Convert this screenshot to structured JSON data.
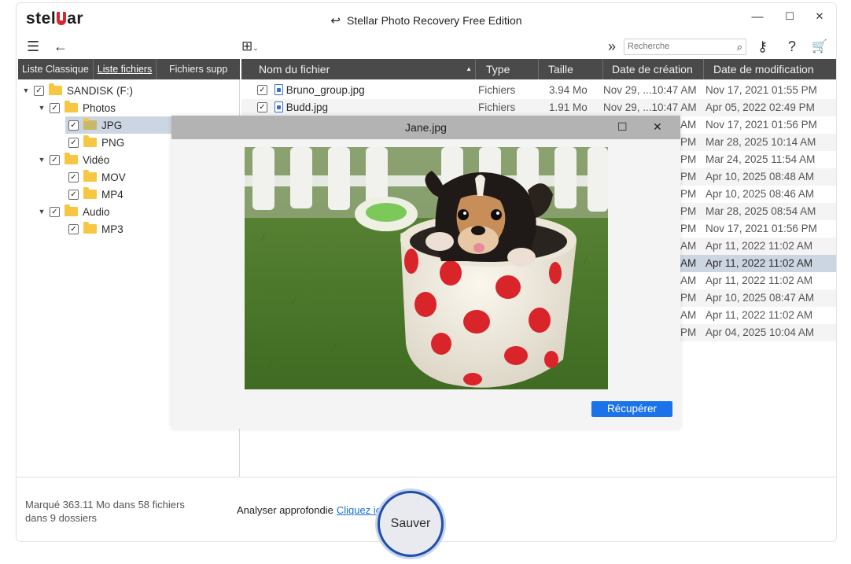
{
  "app": {
    "logo_left": "stel",
    "logo_right": "ar",
    "title": "Stellar Photo Recovery Free Edition",
    "window_controls": [
      "—",
      "☐",
      "✕"
    ]
  },
  "toolbar": {
    "menu_icon": "☰",
    "back_icon": "←",
    "view_icon": "⊞",
    "more_icon": "»",
    "search_placeholder": "Recherche",
    "search_icon": "⌕",
    "key_icon": "⚷",
    "help_icon": "?",
    "cart_icon": "🛒"
  },
  "left_tabs": [
    "Liste Classique",
    "Liste fichiers",
    "Fichiers supp"
  ],
  "tree": [
    {
      "label": "SANDISK (F:)",
      "arrow": "▼",
      "checked": "✓"
    },
    {
      "label": "Photos",
      "arrow": "▼",
      "checked": "✓"
    },
    {
      "label": "JPG",
      "arrow": "",
      "checked": "✓"
    },
    {
      "label": "PNG",
      "arrow": "",
      "checked": "✓"
    },
    {
      "label": "Vidéo",
      "arrow": "▼",
      "checked": "✓"
    },
    {
      "label": "MOV",
      "arrow": "",
      "checked": "✓"
    },
    {
      "label": "MP4",
      "arrow": "",
      "checked": "✓"
    },
    {
      "label": "Audio",
      "arrow": "▼",
      "checked": "✓"
    },
    {
      "label": "MP3",
      "arrow": "",
      "checked": "✓"
    }
  ],
  "table": {
    "columns": [
      "Nom du fichier",
      "Type",
      "Taille",
      "Date de création",
      "Date de modification"
    ],
    "sort_icon": "▲",
    "rows": [
      {
        "name": "Bruno_group.jpg",
        "type": "Fichiers",
        "size": "3.94 Mo",
        "created": "Nov 29, ...10:47 AM",
        "modified": "Nov 17, 2021 01:55 PM"
      },
      {
        "name": "Budd.jpg",
        "type": "Fichiers",
        "size": "1.91 Mo",
        "created": "Nov 29, ...10:47 AM",
        "modified": "Apr 05, 2022 02:49 PM"
      },
      {
        "created": "AM",
        "modified": "Nov 17, 2021 01:56 PM"
      },
      {
        "created": "PM",
        "modified": "Mar 28, 2025 10:14 AM"
      },
      {
        "created": "PM",
        "modified": "Mar 24, 2025 11:54 AM"
      },
      {
        "created": "PM",
        "modified": "Apr 10, 2025 08:48 AM"
      },
      {
        "created": "PM",
        "modified": "Apr 10, 2025 08:46 AM"
      },
      {
        "created": "PM",
        "modified": "Mar 28, 2025 08:54 AM"
      },
      {
        "created": "PM",
        "modified": "Nov 17, 2021 01:56 PM"
      },
      {
        "created": "AM",
        "modified": "Apr 11, 2022 11:02 AM"
      },
      {
        "created": "AM",
        "modified": "Apr 11, 2022 11:02 AM"
      },
      {
        "created": "AM",
        "modified": "Apr 11, 2022 11:02 AM"
      },
      {
        "created": "PM",
        "modified": "Apr 10, 2025 08:47 AM"
      },
      {
        "created": "AM",
        "modified": "Apr 11, 2022 11:02 AM"
      },
      {
        "created": "PM",
        "modified": "Apr 04, 2025 10:04 AM"
      }
    ]
  },
  "footer": {
    "marked_line1": "Marqué 363.11 Mo dans 58 fichiers",
    "marked_line2": "dans 9 dossiers",
    "deep_scan_label": "Analyser approfondie",
    "deep_scan_link": "Cliquez ici",
    "save_label": "Sauver"
  },
  "preview_dialog": {
    "title": "Jane.jpg",
    "maximize_icon": "☐",
    "close_icon": "✕",
    "recover_label": "Récupérer",
    "image_subject": "puppy in a red polka-dot cup"
  },
  "colors": {
    "header_bar": "#4a4a4a",
    "selection": "#ccd6e3",
    "accent_blue": "#1a73e8",
    "brand_red": "#d8272e"
  }
}
